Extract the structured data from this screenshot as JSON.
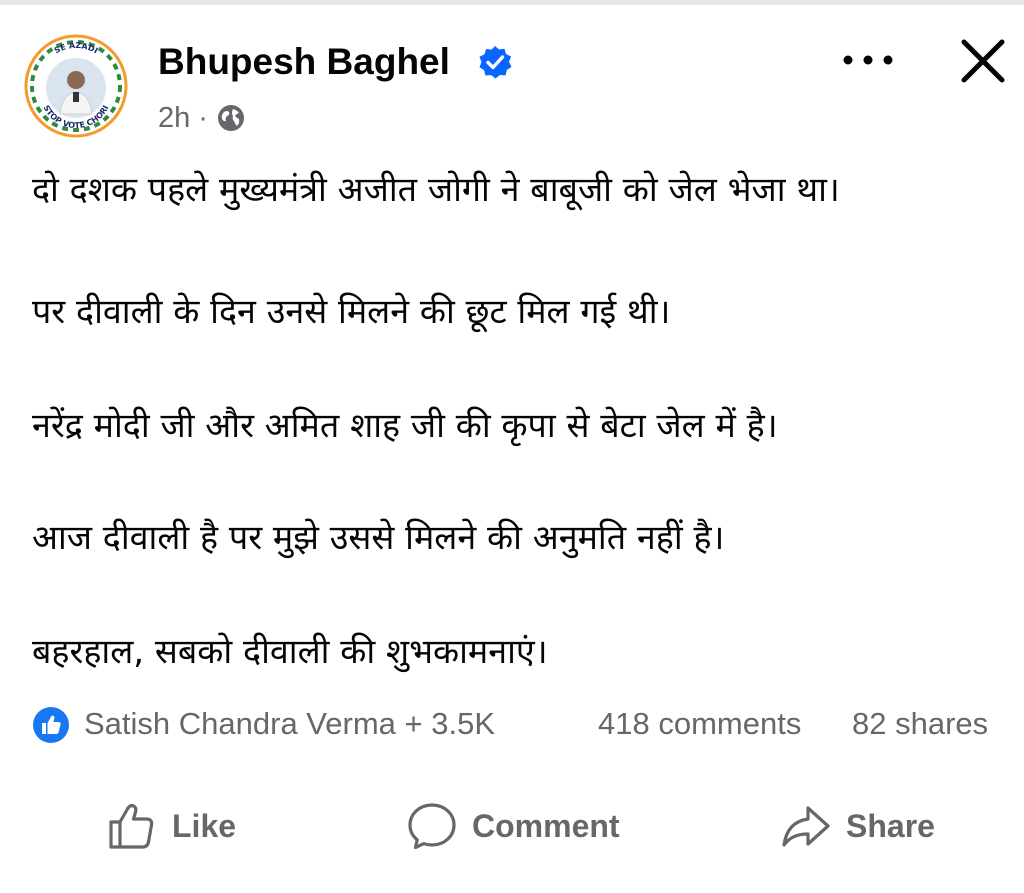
{
  "post": {
    "author": "Bhupesh Baghel",
    "time": "2h",
    "separator": "·",
    "privacy_icon": "globe-icon",
    "avatar_ring_text_top": "SE AZADI",
    "avatar_ring_text_bottom": "STOP VOTE CHORI",
    "lines": [
      "दो दशक पहले मुख्यमंत्री अजीत जोगी ने बाबूजी को जेल भेजा था।",
      "पर दीवाली के दिन उनसे मिलने की छूट मिल गई थी।",
      "नरेंद्र मोदी जी और अमित शाह जी की कृपा से बेटा जेल में है।",
      "आज दीवाली है पर मुझे उससे मिलने की अनुमति नहीं है।",
      "बहरहाल, सबको दीवाली की शुभकामनाएं।"
    ]
  },
  "reactions": {
    "summary": "Satish Chandra Verma + 3.5K",
    "comments": "418 comments",
    "shares": "82 shares"
  },
  "actions": {
    "like": "Like",
    "comment": "Comment",
    "share": "Share"
  },
  "colors": {
    "text": "#050505",
    "secondary": "#65676b",
    "verified": "#0866ff",
    "like_badge": "#1877f2"
  }
}
